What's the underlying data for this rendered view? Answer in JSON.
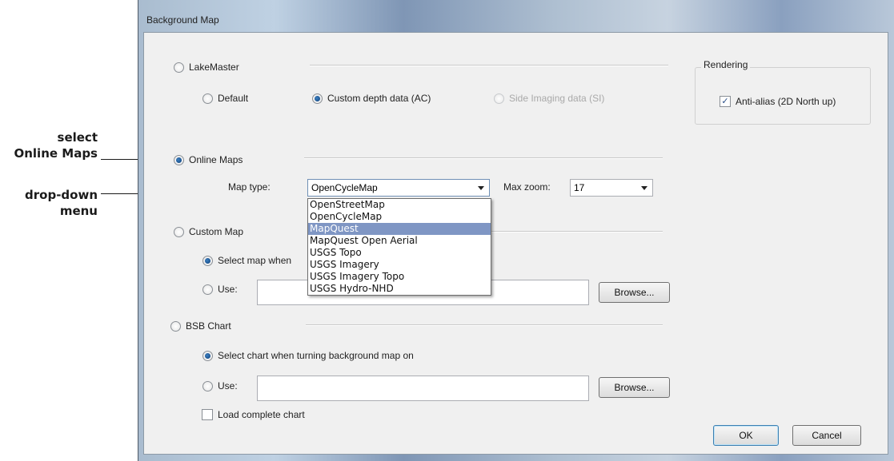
{
  "callouts": {
    "online_maps_line1": "select",
    "online_maps_line2": "Online Maps",
    "dropdown_line1": "drop-down",
    "dropdown_line2": "menu"
  },
  "window": {
    "title": "Background Map"
  },
  "lakemaster": {
    "label": "LakeMaster",
    "options": {
      "default": "Default",
      "custom": "Custom depth data (AC)",
      "side": "Side Imaging data (SI)"
    }
  },
  "rendering": {
    "group_label": "Rendering",
    "antialias_label": "Anti-alias (2D North up)"
  },
  "online_maps": {
    "label": "Online Maps",
    "map_type_label": "Map type:",
    "map_type_value": "OpenCycleMap",
    "max_zoom_label": "Max zoom:",
    "max_zoom_value": "17",
    "dropdown_items": [
      "OpenStreetMap",
      "OpenCycleMap",
      "MapQuest",
      "MapQuest Open Aerial",
      "USGS Topo",
      "USGS Imagery",
      "USGS Imagery Topo",
      "USGS Hydro-NHD"
    ],
    "highlighted": "MapQuest"
  },
  "custom_map": {
    "label": "Custom Map",
    "select_label": "Select map when",
    "use_label": "Use:",
    "browse": "Browse..."
  },
  "bsb_chart": {
    "label": "BSB Chart",
    "select_label": "Select chart when turning background map on",
    "use_label": "Use:",
    "browse": "Browse...",
    "load_complete": "Load complete chart"
  },
  "buttons": {
    "ok": "OK",
    "cancel": "Cancel"
  }
}
